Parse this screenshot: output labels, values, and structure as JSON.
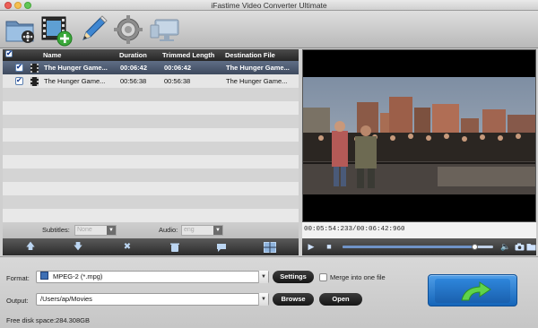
{
  "window": {
    "title": "iFastime Video Converter Ultimate"
  },
  "toolbar": {
    "buttons": [
      {
        "name": "add-video-button",
        "icon": "folder-film-icon"
      },
      {
        "name": "add-files-button",
        "icon": "film-plus-icon"
      },
      {
        "name": "edit-button",
        "icon": "pencil-icon"
      },
      {
        "name": "settings-button",
        "icon": "gear-icon"
      },
      {
        "name": "monitor-button",
        "icon": "monitor-icon"
      }
    ]
  },
  "file_list": {
    "columns": [
      "Name",
      "Duration",
      "Trimmed Length",
      "Destination File"
    ],
    "rows": [
      {
        "name": "The Hunger Game...",
        "duration": "00:06:42",
        "trimmed": "00:06:42",
        "destination": "The Hunger Game..."
      },
      {
        "name": "The Hunger Game...",
        "duration": "00:56:38",
        "trimmed": "00:56:38",
        "destination": "The Hunger Game..."
      }
    ]
  },
  "subtitles": {
    "label": "Subtitles:",
    "value": "None"
  },
  "audio": {
    "label": "Audio:",
    "value": "eng"
  },
  "preview": {
    "timecode": "00:05:54:233/00:06:42:960",
    "progress": 0.88
  },
  "output": {
    "format_label": "Format:",
    "format_value": "MPEG-2 (*.mpg)",
    "settings_button": "Settings",
    "merge_label": "Merge into one file",
    "output_label": "Output:",
    "output_path": "/Users/ap/Movies",
    "browse_button": "Browse",
    "open_button": "Open",
    "free_disk": "Free disk space:284.308GB"
  },
  "colors": {
    "accent": "#1a6fc9",
    "arrow": "#4fcf3f",
    "selected_row": "#4a576c"
  }
}
